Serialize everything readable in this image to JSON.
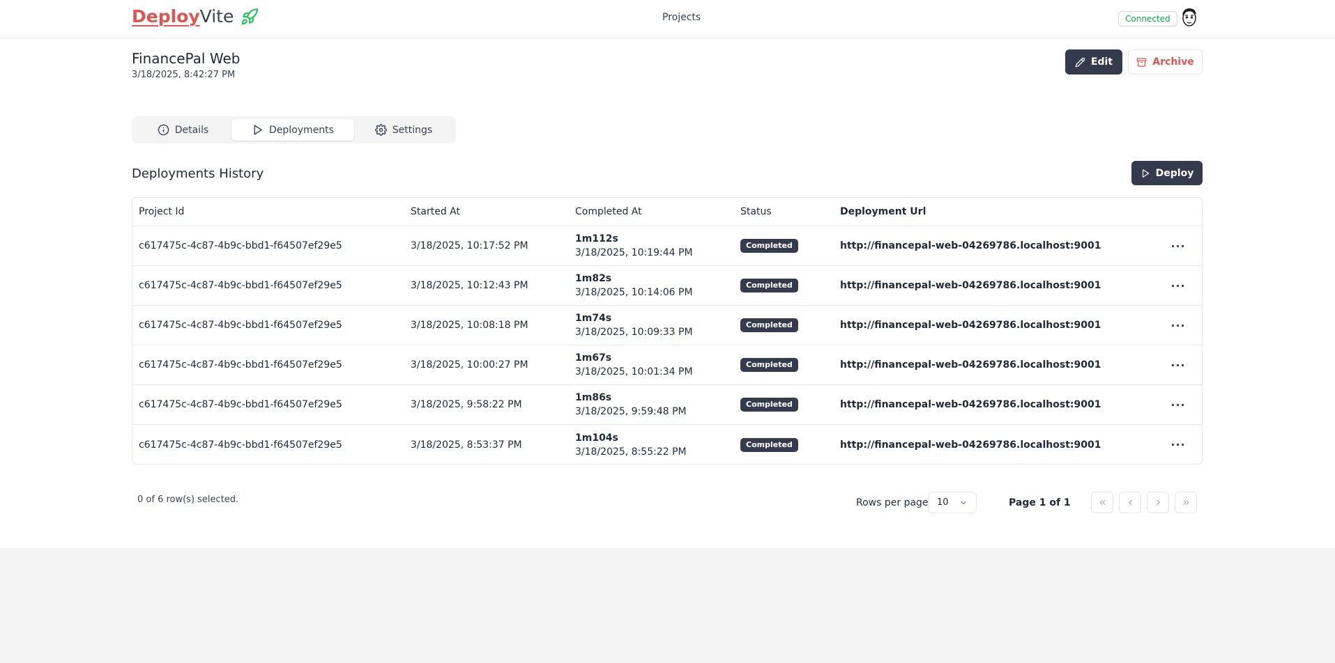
{
  "brand": {
    "part1": "Deploy",
    "part2": "Vite",
    "icon": "rocket-icon"
  },
  "nav": {
    "projects": "Projects"
  },
  "connection": {
    "status": "Connected",
    "color": "#16a34a"
  },
  "project": {
    "name": "FinancePal Web",
    "date": "3/18/2025, 8:42:27 PM"
  },
  "actions": {
    "edit": "Edit",
    "archive": "Archive"
  },
  "tabs": [
    {
      "label": "Details",
      "icon": "info-icon"
    },
    {
      "label": "Deployments",
      "icon": "play-icon",
      "active": true
    },
    {
      "label": "Settings",
      "icon": "gear-icon"
    }
  ],
  "section": {
    "title": "Deployments History",
    "deploy_label": "Deploy"
  },
  "table": {
    "headers": [
      "Project Id",
      "Started At",
      "Completed At",
      "Status",
      "Deployment Url"
    ],
    "rows": [
      {
        "project_id": "c617475c-4c87-4b9c-bbd1-f64507ef29e5",
        "started": "3/18/2025, 10:17:52 PM",
        "duration": "1m112s",
        "completed": "3/18/2025, 10:19:44 PM",
        "status": "Completed",
        "url": "http://financepal-web-04269786.localhost:9001"
      },
      {
        "project_id": "c617475c-4c87-4b9c-bbd1-f64507ef29e5",
        "started": "3/18/2025, 10:12:43 PM",
        "duration": "1m82s",
        "completed": "3/18/2025, 10:14:06 PM",
        "status": "Completed",
        "url": "http://financepal-web-04269786.localhost:9001"
      },
      {
        "project_id": "c617475c-4c87-4b9c-bbd1-f64507ef29e5",
        "started": "3/18/2025, 10:08:18 PM",
        "duration": "1m74s",
        "completed": "3/18/2025, 10:09:33 PM",
        "status": "Completed",
        "url": "http://financepal-web-04269786.localhost:9001"
      },
      {
        "project_id": "c617475c-4c87-4b9c-bbd1-f64507ef29e5",
        "started": "3/18/2025, 10:00:27 PM",
        "duration": "1m67s",
        "completed": "3/18/2025, 10:01:34 PM",
        "status": "Completed",
        "url": "http://financepal-web-04269786.localhost:9001"
      },
      {
        "project_id": "c617475c-4c87-4b9c-bbd1-f64507ef29e5",
        "started": "3/18/2025, 9:58:22 PM",
        "duration": "1m86s",
        "completed": "3/18/2025, 9:59:48 PM",
        "status": "Completed",
        "url": "http://financepal-web-04269786.localhost:9001"
      },
      {
        "project_id": "c617475c-4c87-4b9c-bbd1-f64507ef29e5",
        "started": "3/18/2025, 8:53:37 PM",
        "duration": "1m104s",
        "completed": "3/18/2025, 8:55:22 PM",
        "status": "Completed",
        "url": "http://financepal-web-04269786.localhost:9001"
      }
    ]
  },
  "footer": {
    "selected": "0 of 6 row(s) selected.",
    "rows_per_page_label": "Rows per page",
    "rows_per_page_value": "10",
    "page_label": "Page 1 of 1"
  },
  "colors": {
    "brand_red": "#e0554f",
    "dark_button": "#343b4c"
  }
}
